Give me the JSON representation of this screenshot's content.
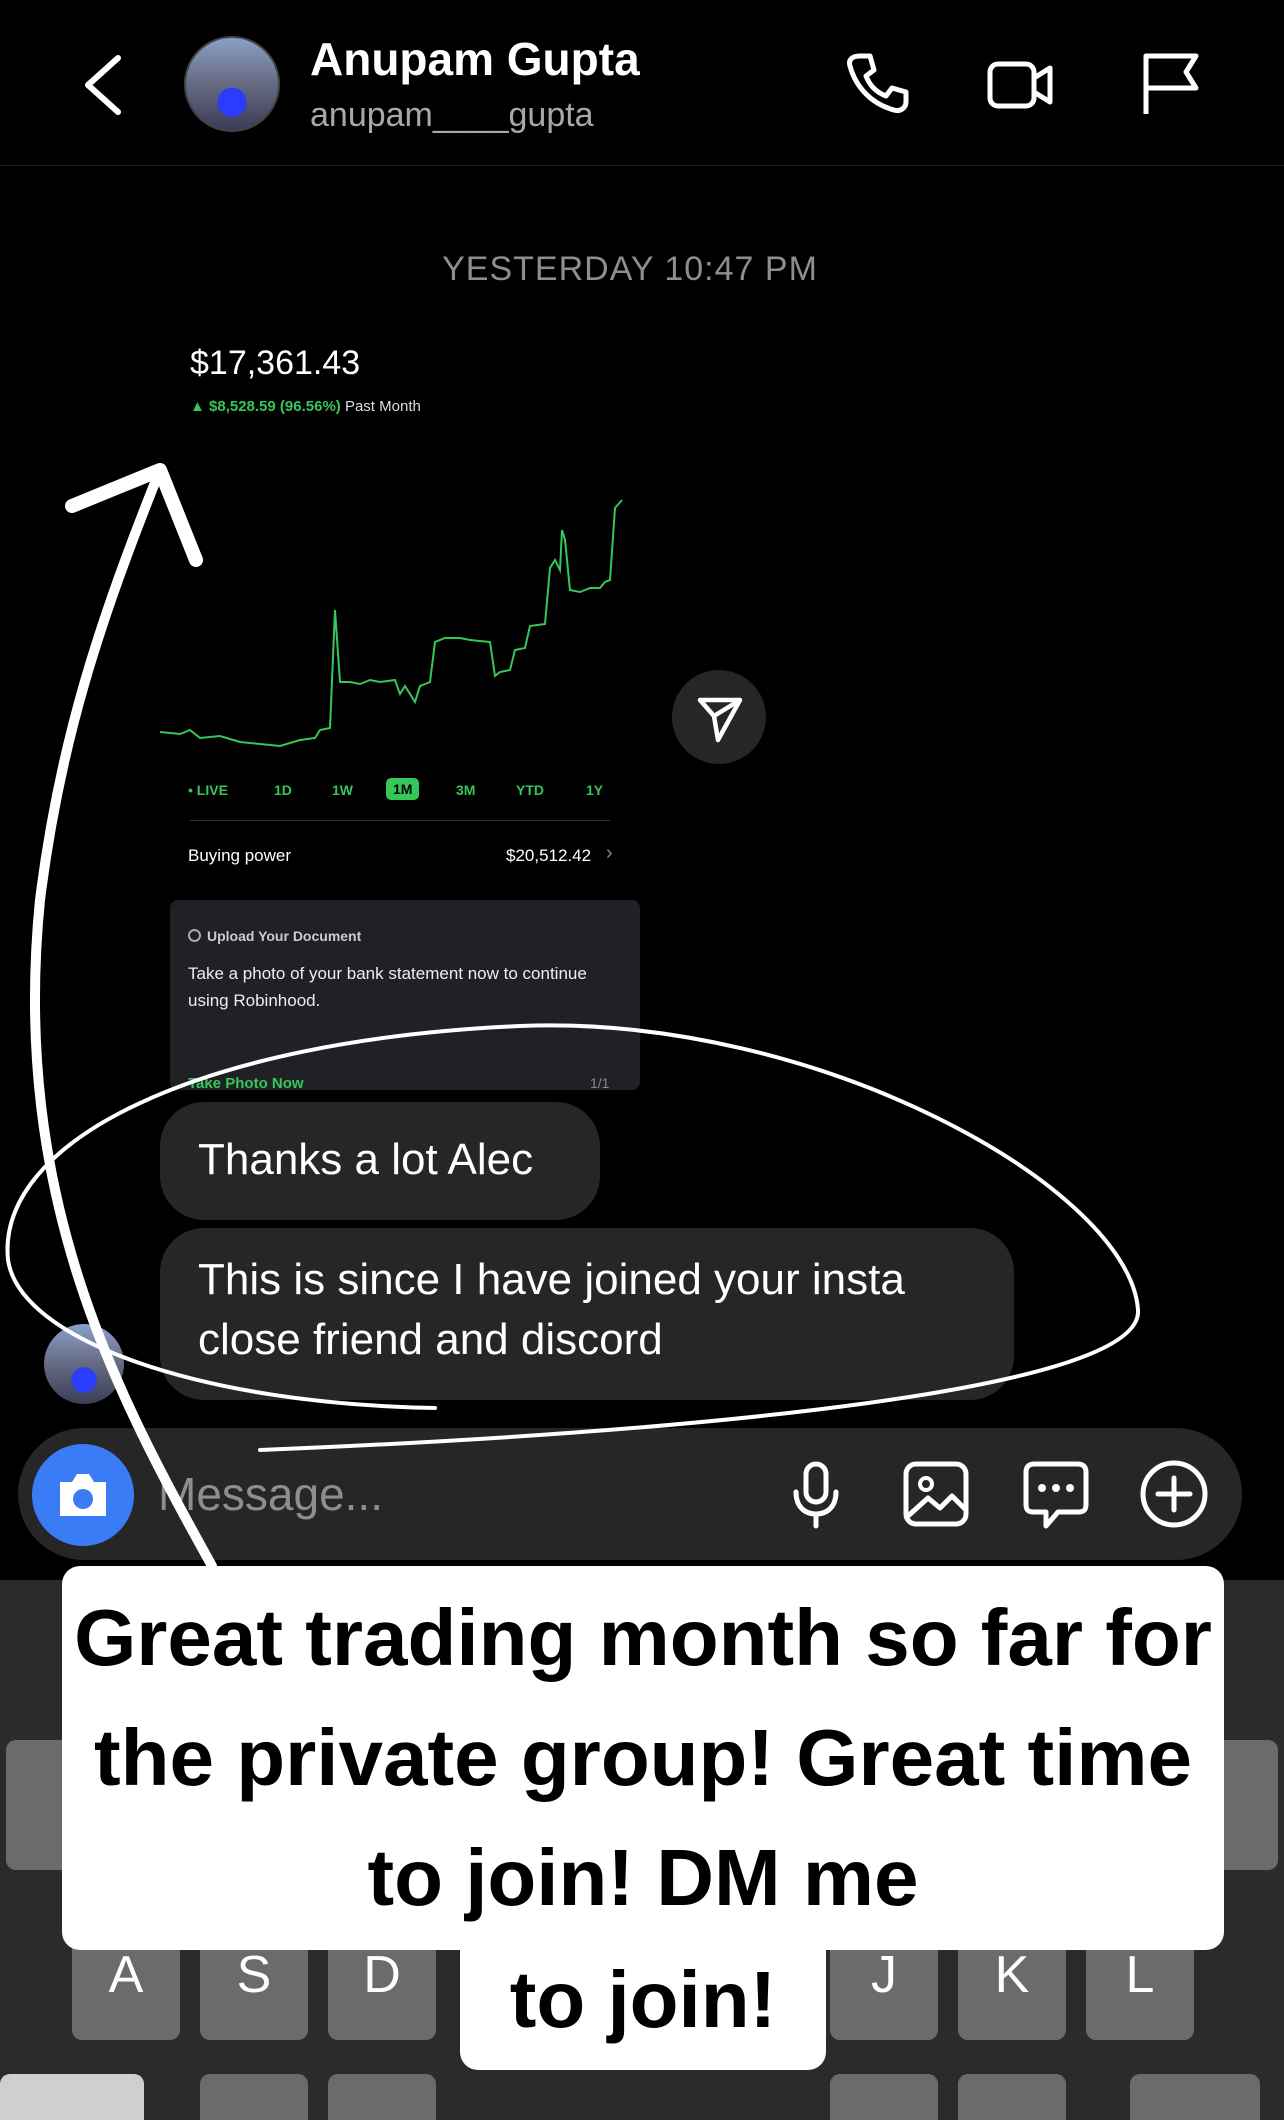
{
  "header": {
    "name": "Anupam Gupta",
    "username": "anupam____gupta",
    "back_icon": "chevron-left-icon",
    "call_icon": "phone-icon",
    "video_icon": "video-icon",
    "report_icon": "flag-icon"
  },
  "thread": {
    "timestamp": "YESTERDAY 10:47 PM",
    "shared_screenshot": {
      "balance": "$17,361.43",
      "change": "▲ $8,528.59 (96.56%)",
      "change_period": "Past Month",
      "tabs": [
        "• LIVE",
        "1D",
        "1W",
        "1M",
        "3M",
        "YTD",
        "1Y"
      ],
      "active_tab": "1M",
      "buying_power_label": "Buying power",
      "buying_power_value": "$20,512.42",
      "card_title": "Upload Your Document",
      "card_body": "Take a photo of your bank statement now to continue using Robinhood.",
      "card_link": "Take Photo Now",
      "card_pager": "1/1",
      "accent": "#35c759"
    },
    "messages": [
      {
        "text": "Thanks a lot Alec"
      },
      {
        "text": "This is since I have joined your insta close friend and discord"
      }
    ]
  },
  "composer": {
    "placeholder": "Message...",
    "camera_icon": "camera-icon",
    "mic_icon": "microphone-icon",
    "gallery_icon": "image-icon",
    "sticker_icon": "chat-bubble-icon",
    "more_icon": "plus-circle-icon",
    "camera_color": "#3a7bf6"
  },
  "keyboard": {
    "visible_keys": [
      "A",
      "S",
      "D",
      "J",
      "K",
      "L"
    ]
  },
  "caption": {
    "line1": "Great trading month so far for the private group! Great time to join! DM me",
    "line2": "to join!"
  }
}
